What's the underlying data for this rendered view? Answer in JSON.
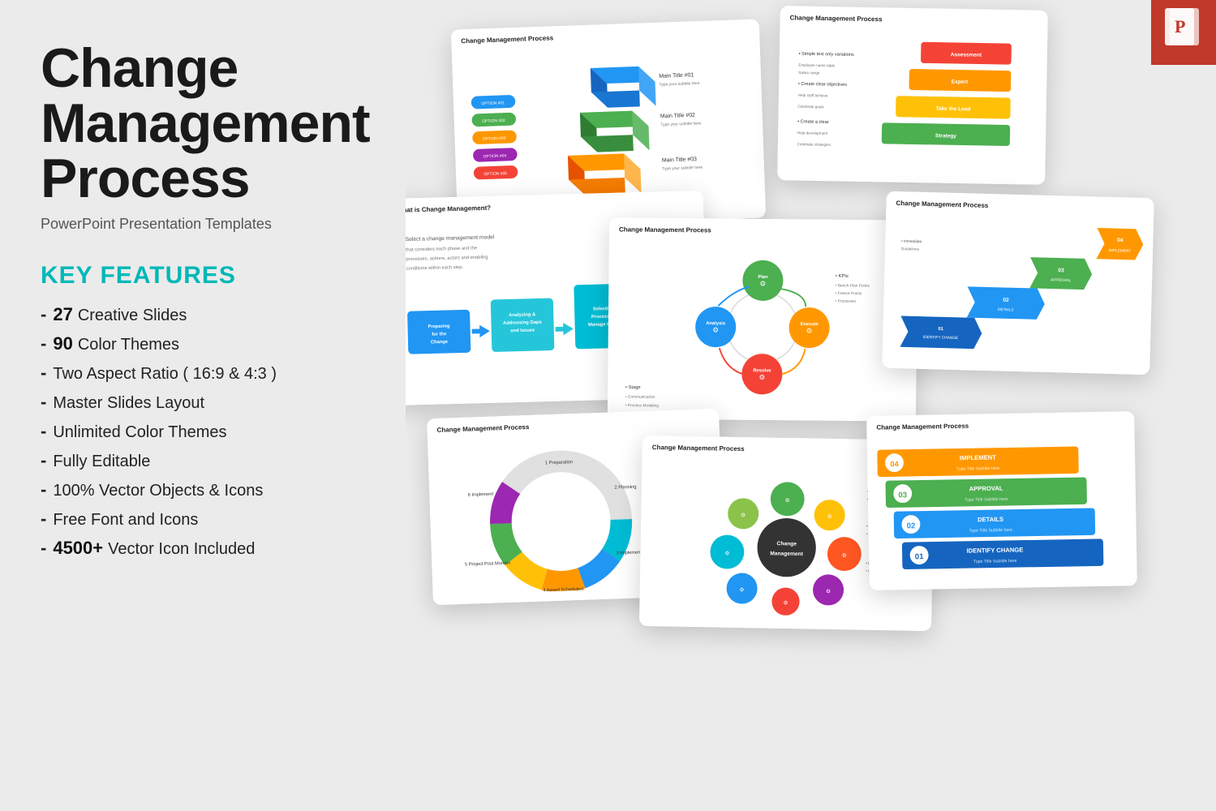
{
  "title": {
    "line1": "Change Management",
    "line2": "Process",
    "subtitle": "PowerPoint Presentation Templates"
  },
  "keyFeatures": {
    "label": "KEY FEATURES",
    "items": [
      {
        "id": "creative-slides",
        "bold": "27",
        "text": " Creative Slides"
      },
      {
        "id": "color-themes",
        "bold": "90",
        "text": " Color Themes"
      },
      {
        "id": "aspect-ratio",
        "bold": "",
        "text": "Two Aspect Ratio ( 16:9 & 4:3 )"
      },
      {
        "id": "master-slides",
        "bold": "",
        "text": "Master Slides Layout"
      },
      {
        "id": "unlimited-themes",
        "bold": "",
        "text": "Unlimited Color Themes"
      },
      {
        "id": "fully-editable",
        "bold": "",
        "text": "Fully Editable"
      },
      {
        "id": "vector-objects",
        "bold": "",
        "text": "100% Vector Objects & Icons"
      },
      {
        "id": "free-font",
        "bold": "",
        "text": "Free Font and Icons"
      },
      {
        "id": "vector-icon",
        "bold": "4500+",
        "text": " Vector Icon Included"
      }
    ]
  },
  "pptBadge": {
    "icon": "P"
  },
  "slides": {
    "slideTitle": "Change Management Process"
  },
  "colors": {
    "teal": "#00b8b8",
    "orange": "#e8740c",
    "blue": "#2196F3",
    "green": "#4CAF50",
    "red": "#c0392b",
    "yellow": "#FFC107",
    "purple": "#9C27B0",
    "darkBlue": "#1565C0"
  }
}
